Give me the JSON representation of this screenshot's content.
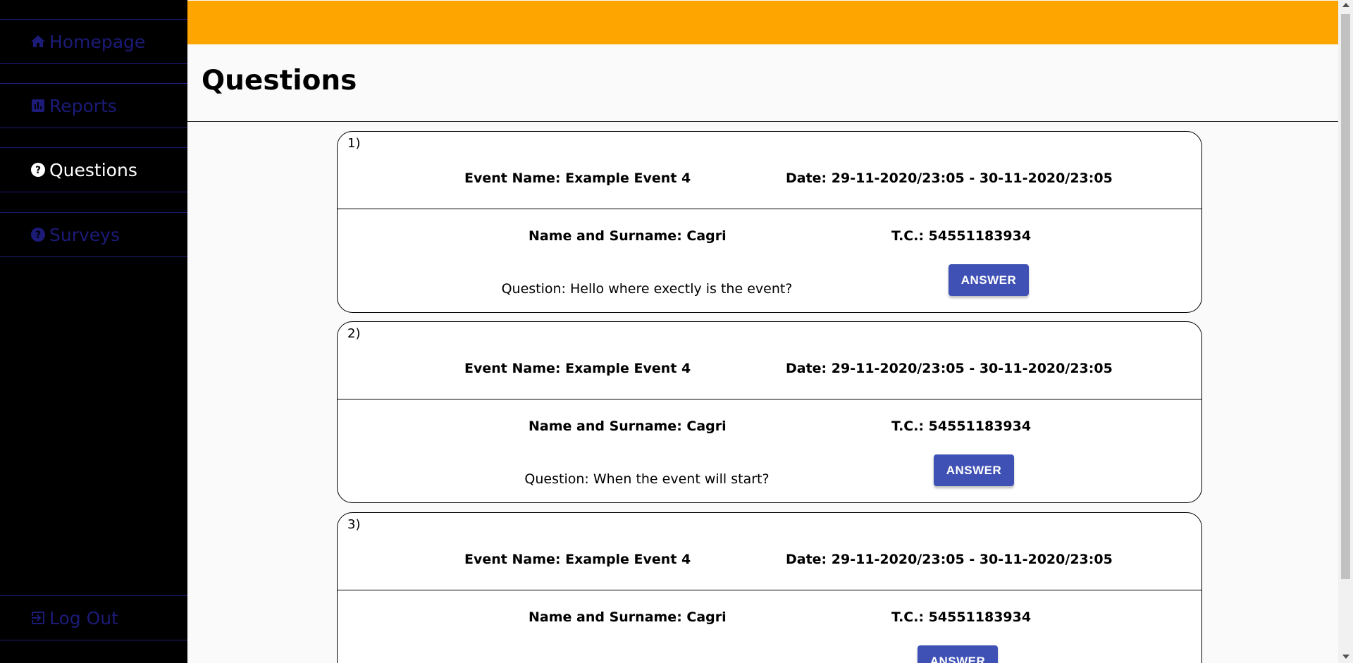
{
  "sidebar": {
    "items": [
      {
        "label": "Homepage",
        "icon": "home-icon"
      },
      {
        "label": "Reports",
        "icon": "chart-icon"
      },
      {
        "label": "Questions",
        "icon": "help-circle-icon"
      },
      {
        "label": "Surveys",
        "icon": "help-circle-icon"
      }
    ],
    "logout": {
      "label": "Log Out",
      "icon": "logout-icon"
    }
  },
  "header": {
    "title": "Questions"
  },
  "colors": {
    "topbar": "#ffa500",
    "nav_text": "#1c1b78",
    "button": "#3f51b5"
  },
  "questions": [
    {
      "index": "1)",
      "event_name": "Event Name: Example Event 4",
      "date": "Date: 29-11-2020/23:05 - 30-11-2020/23:05",
      "name": "Name and Surname: Cagri",
      "tc": "T.C.: 54551183934",
      "question": "Question: Hello where exectly is the event?",
      "answer_label": "ANSWER"
    },
    {
      "index": "2)",
      "event_name": "Event Name: Example Event 4",
      "date": "Date: 29-11-2020/23:05 - 30-11-2020/23:05",
      "name": "Name and Surname: Cagri",
      "tc": "T.C.: 54551183934",
      "question": "Question: When the event will start?",
      "answer_label": "ANSWER"
    },
    {
      "index": "3)",
      "event_name": "Event Name: Example Event 4",
      "date": "Date: 29-11-2020/23:05 - 30-11-2020/23:05",
      "name": "Name and Surname: Cagri",
      "tc": "T.C.: 54551183934",
      "question": "",
      "answer_label": "ANSWER"
    }
  ]
}
